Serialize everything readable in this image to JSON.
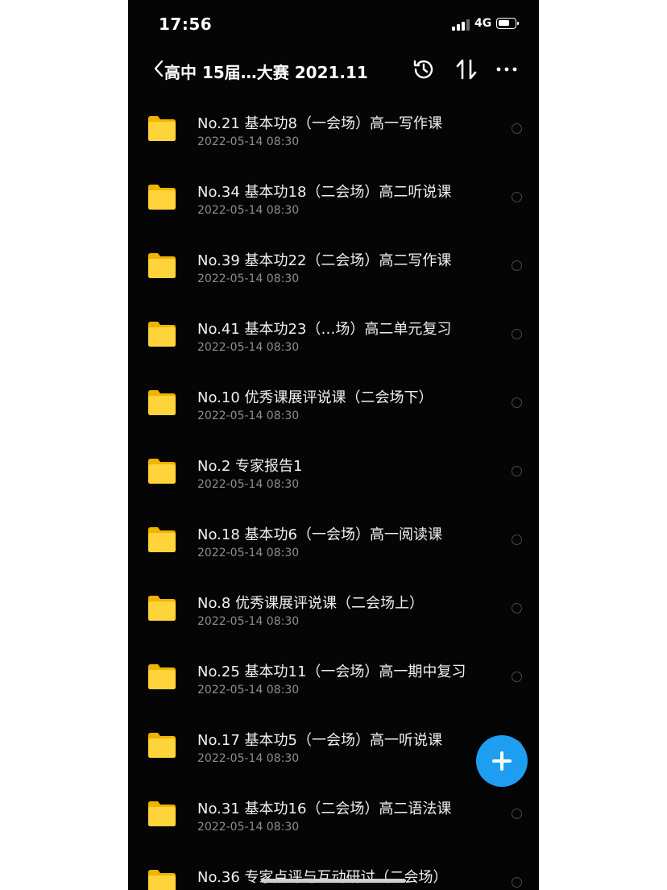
{
  "status_bar": {
    "time": "17:56",
    "network": "4G"
  },
  "nav": {
    "back_icon": "chevron-left-icon",
    "title": "高中 15届…大赛 2021.11",
    "actions": [
      "history-icon",
      "sort-icon",
      "more-icon"
    ]
  },
  "files": [
    {
      "name": "No.21 基本功8（一会场）高一写作课",
      "date": "2022-05-14 08:30"
    },
    {
      "name": "No.34 基本功18（二会场）高二听说课",
      "date": "2022-05-14 08:30"
    },
    {
      "name": "No.39 基本功22（二会场）高二写作课",
      "date": "2022-05-14 08:30"
    },
    {
      "name": "No.41 基本功23（…场）高二单元复习",
      "date": "2022-05-14 08:30"
    },
    {
      "name": "No.10 优秀课展评说课（二会场下）",
      "date": "2022-05-14 08:30"
    },
    {
      "name": "No.2 专家报告1",
      "date": "2022-05-14 08:30"
    },
    {
      "name": "No.18 基本功6（一会场）高一阅读课",
      "date": "2022-05-14 08:30"
    },
    {
      "name": "No.8 优秀课展评说课（二会场上）",
      "date": "2022-05-14 08:30"
    },
    {
      "name": "No.25 基本功11（一会场）高一期中复习",
      "date": "2022-05-14 08:30"
    },
    {
      "name": "No.17 基本功5（一会场）高一听说课",
      "date": "2022-05-14 08:30"
    },
    {
      "name": "No.31 基本功16（二会场）高二语法课",
      "date": "2022-05-14 08:30"
    },
    {
      "name": "No.36 专家点评与互动研讨（二会场）",
      "date": ""
    }
  ],
  "colors": {
    "background": "#050505",
    "folder": "#FFCC2E",
    "fab": "#1E9EF0",
    "secondary_text": "#8E8E93"
  },
  "fab_icon": "plus-icon"
}
